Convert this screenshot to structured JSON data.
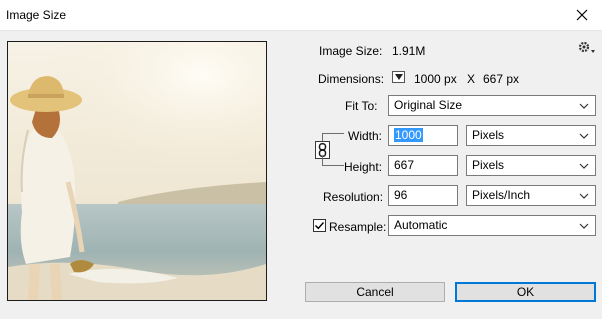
{
  "window": {
    "title": "Image Size",
    "close_icon": "close-icon"
  },
  "image_size": {
    "label": "Image Size:",
    "value": "1.91M"
  },
  "dimensions": {
    "label": "Dimensions:",
    "width_value": "1000 px",
    "separator": "X",
    "height_value": "667 px"
  },
  "fit_to": {
    "label": "Fit To:",
    "selected": "Original Size"
  },
  "width": {
    "label": "Width:",
    "value": "1000",
    "unit": "Pixels"
  },
  "height": {
    "label": "Height:",
    "value": "667",
    "unit": "Pixels"
  },
  "resolution": {
    "label": "Resolution:",
    "value": "96",
    "unit": "Pixels/Inch"
  },
  "resample": {
    "label": "Resample:",
    "checked": true,
    "selected": "Automatic"
  },
  "buttons": {
    "cancel": "Cancel",
    "ok": "OK"
  },
  "colors": {
    "focus_blue": "#0078d7",
    "selection_blue": "#3399ff",
    "dialog_bg": "#f0f0f0"
  },
  "icons": [
    "close-icon",
    "gear-icon",
    "chain-link-icon",
    "chevron-down-icon",
    "triangle-down-icon",
    "checkmark-icon"
  ]
}
